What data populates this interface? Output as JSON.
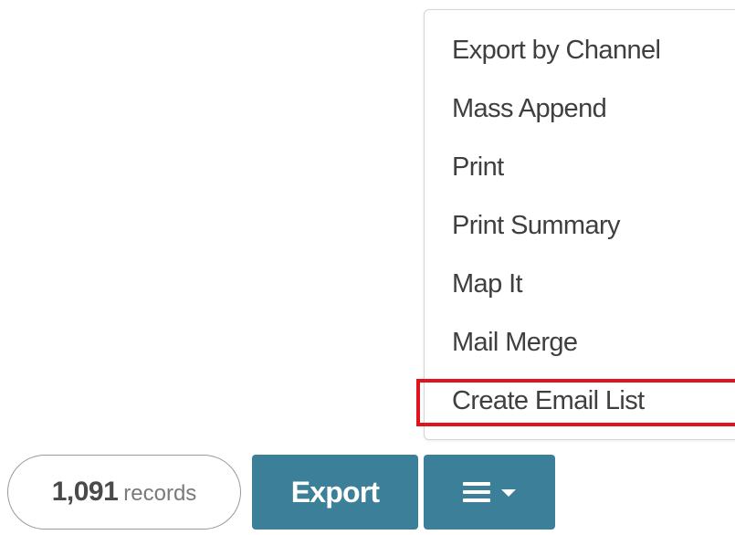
{
  "dropdown": {
    "items": [
      {
        "label": "Export by Channel"
      },
      {
        "label": "Mass Append"
      },
      {
        "label": "Print"
      },
      {
        "label": "Print Summary"
      },
      {
        "label": "Map It"
      },
      {
        "label": "Mail Merge"
      },
      {
        "label": "Create Email List"
      }
    ],
    "highlighted_item": "Create Email List"
  },
  "records": {
    "count": "1,091",
    "label": "records"
  },
  "toolbar": {
    "export_label": "Export",
    "menu_icon": "hamburger-icon",
    "caret_icon": "caret-down-icon"
  },
  "colors": {
    "button_bg": "#3b7f99",
    "highlight": "#e0141e",
    "menu_text": "#3f3f3f"
  }
}
